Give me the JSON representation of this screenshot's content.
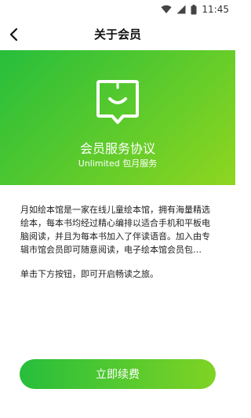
{
  "status_bar": {
    "time": "11:45",
    "icons": [
      "wifi-icon",
      "signal-icon",
      "battery-icon"
    ]
  },
  "nav": {
    "title": "关于会员",
    "back_icon": "chevron-left-icon"
  },
  "hero": {
    "logo_icon": "smile-book-icon",
    "title": "会员服务协议",
    "subtitle": "Unlimited 包月服务",
    "colors": {
      "gradient_start": "#27be3c",
      "gradient_end": "#8fd620"
    }
  },
  "content": {
    "paragraph_1": "月如绘本馆是一家在线儿童绘本馆，拥有海量精选绘本，每本书均经过精心编排以适合手机和平板电脑阅读，并且为每本书加入了伴读语音。加入由专辑市馆会员即可随意阅读，电子绘本馆会员包…",
    "paragraph_2": "单击下方按钮，即可开启畅读之旅。"
  },
  "cta": {
    "label": "立即续费"
  }
}
